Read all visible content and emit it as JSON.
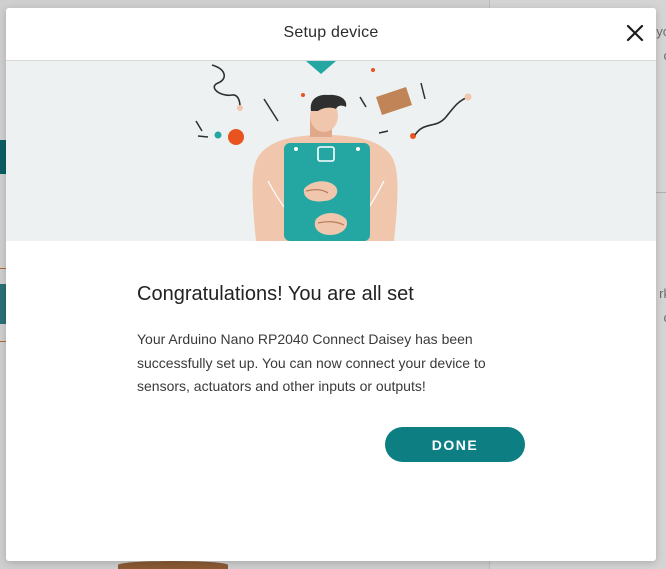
{
  "background": {
    "right_text_lines": [
      "yo",
      "c",
      "rk",
      "c"
    ]
  },
  "modal": {
    "title": "Setup device",
    "close_icon": "close-icon",
    "heading": "Congratulations! You are all set",
    "body": "Your Arduino Nano RP2040 Connect Daisey has been successfully set up. You can now connect your device to sensors, actuators and other inputs or outputs!",
    "body_lines": [
      "Your Arduino Nano RP2040 Connect Daisey has been",
      "successfully set up. You can now connect your device to",
      "sensors, actuators and other inputs or outputs!"
    ],
    "done_label": "DONE",
    "colors": {
      "accent": "#0d7f83",
      "illustration_bg": "#eef1f1",
      "skin": "#f0c7ad",
      "device_teal": "#24a6a3",
      "orange_dot": "#e8531f"
    }
  }
}
